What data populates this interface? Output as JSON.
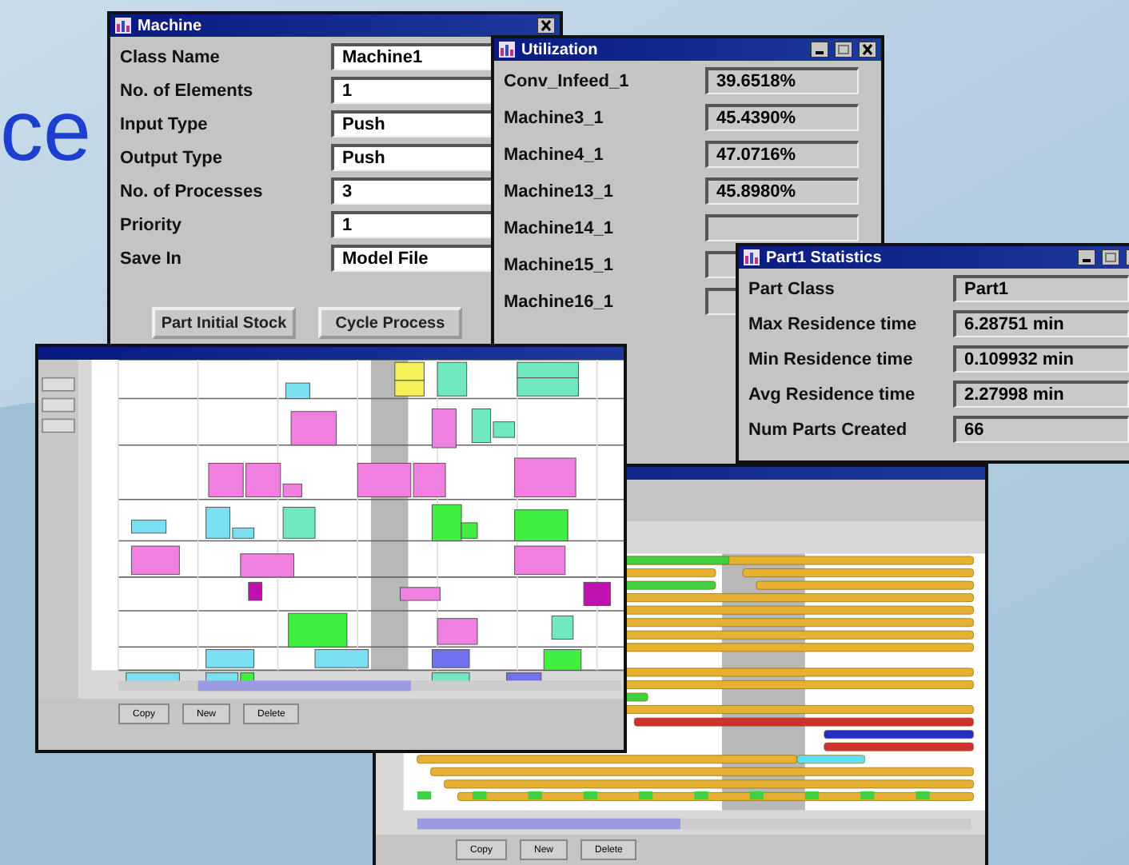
{
  "slide_title": "ce",
  "machine_window": {
    "title": "Machine",
    "fields": [
      {
        "label": "Class Name",
        "value": "Machine1"
      },
      {
        "label": "No. of Elements",
        "value": "1"
      },
      {
        "label": "Input Type",
        "value": "Push"
      },
      {
        "label": "Output Type",
        "value": "Push"
      },
      {
        "label": "No. of Processes",
        "value": "3"
      },
      {
        "label": "Priority",
        "value": "1"
      },
      {
        "label": "Save In",
        "value": "Model File"
      }
    ],
    "buttons": [
      "Part Initial Stock",
      "Cycle Process"
    ]
  },
  "utilization_window": {
    "title": "Utilization",
    "rows": [
      {
        "label": "Conv_Infeed_1",
        "value": "39.6518%"
      },
      {
        "label": "Machine3_1",
        "value": "45.4390%"
      },
      {
        "label": "Machine4_1",
        "value": "47.0716%"
      },
      {
        "label": "Machine13_1",
        "value": "45.8980%"
      },
      {
        "label": "Machine14_1"
      },
      {
        "label": "Machine15_1"
      },
      {
        "label": "Machine16_1"
      }
    ]
  },
  "part_statistics_window": {
    "title": "Part1 Statistics",
    "rows": [
      {
        "label": "Part Class",
        "value": "Part1"
      },
      {
        "label": "Max Residence time",
        "value": "6.28751 min"
      },
      {
        "label": "Min Residence time",
        "value": "0.109932 min"
      },
      {
        "label": "Avg Residence time",
        "value": "2.27998 min"
      },
      {
        "label": "Num Parts Created",
        "value": "66"
      }
    ]
  },
  "planning_windows": [
    {
      "kind": "blocks",
      "buttons": [
        "Copy",
        "New",
        "Delete"
      ]
    },
    {
      "kind": "bars",
      "buttons": [
        "Copy",
        "New",
        "Delete"
      ]
    }
  ]
}
